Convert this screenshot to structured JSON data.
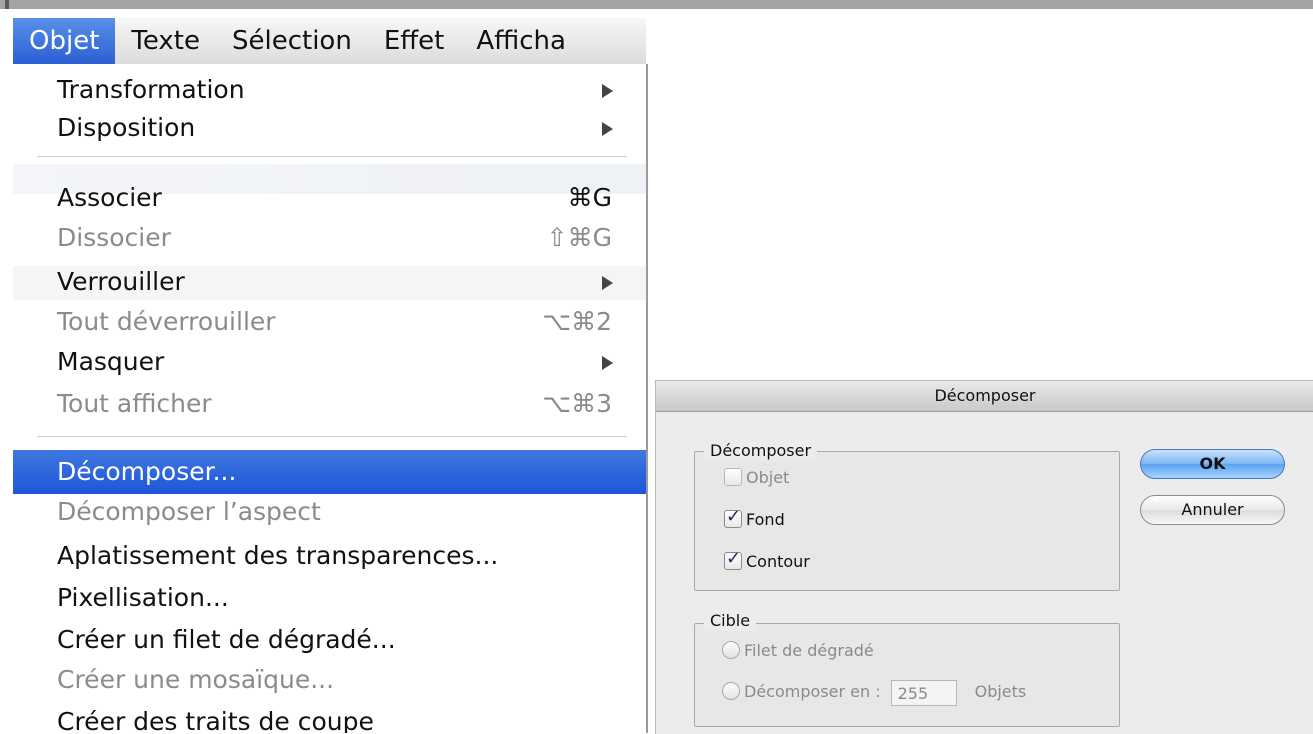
{
  "menubar": {
    "items": [
      "Objet",
      "Texte",
      "Sélection",
      "Effet",
      "Afficha"
    ]
  },
  "menu": {
    "items": [
      {
        "label": "Transformation",
        "shortcut": "",
        "submenu": true,
        "disabled": false
      },
      {
        "label": "Disposition",
        "shortcut": "",
        "submenu": true,
        "disabled": false
      },
      {
        "label": "Associer",
        "shortcut": "⌘G",
        "submenu": false,
        "disabled": false
      },
      {
        "label": "Dissocier",
        "shortcut": "⇧⌘G",
        "submenu": false,
        "disabled": true
      },
      {
        "label": "Verrouiller",
        "shortcut": "",
        "submenu": true,
        "disabled": false
      },
      {
        "label": "Tout déverrouiller",
        "shortcut": "⌥⌘2",
        "submenu": false,
        "disabled": true
      },
      {
        "label": "Masquer",
        "shortcut": "",
        "submenu": true,
        "disabled": false
      },
      {
        "label": "Tout afficher",
        "shortcut": "⌥⌘3",
        "submenu": false,
        "disabled": true
      },
      {
        "label": "Décomposer...",
        "shortcut": "",
        "submenu": false,
        "disabled": false,
        "highlighted": true
      },
      {
        "label": "Décomposer l’aspect",
        "shortcut": "",
        "submenu": false,
        "disabled": true
      },
      {
        "label": "Aplatissement des transparences...",
        "shortcut": "",
        "submenu": false,
        "disabled": false
      },
      {
        "label": "Pixellisation...",
        "shortcut": "",
        "submenu": false,
        "disabled": false
      },
      {
        "label": "Créer un filet de dégradé...",
        "shortcut": "",
        "submenu": false,
        "disabled": false
      },
      {
        "label": "Créer une mosaïque...",
        "shortcut": "",
        "submenu": false,
        "disabled": true
      },
      {
        "label": "Créer des traits de coupe",
        "shortcut": "",
        "submenu": false,
        "disabled": false
      }
    ]
  },
  "dialog": {
    "title": "Décomposer",
    "group_decompose": {
      "title": "Décomposer",
      "options": [
        {
          "label": "Objet",
          "checked": false,
          "disabled": true
        },
        {
          "label": "Fond",
          "checked": true,
          "disabled": false
        },
        {
          "label": "Contour",
          "checked": true,
          "disabled": false
        }
      ]
    },
    "group_target": {
      "title": "Cible",
      "radio1": "Filet de dégradé",
      "radio2": "Décomposer en :",
      "count_value": "255",
      "count_unit": "Objets"
    },
    "ok_label": "OK",
    "cancel_label": "Annuler"
  },
  "colors": {
    "highlight": "#2b5fd4",
    "ok_button": "#7ab5f4"
  }
}
